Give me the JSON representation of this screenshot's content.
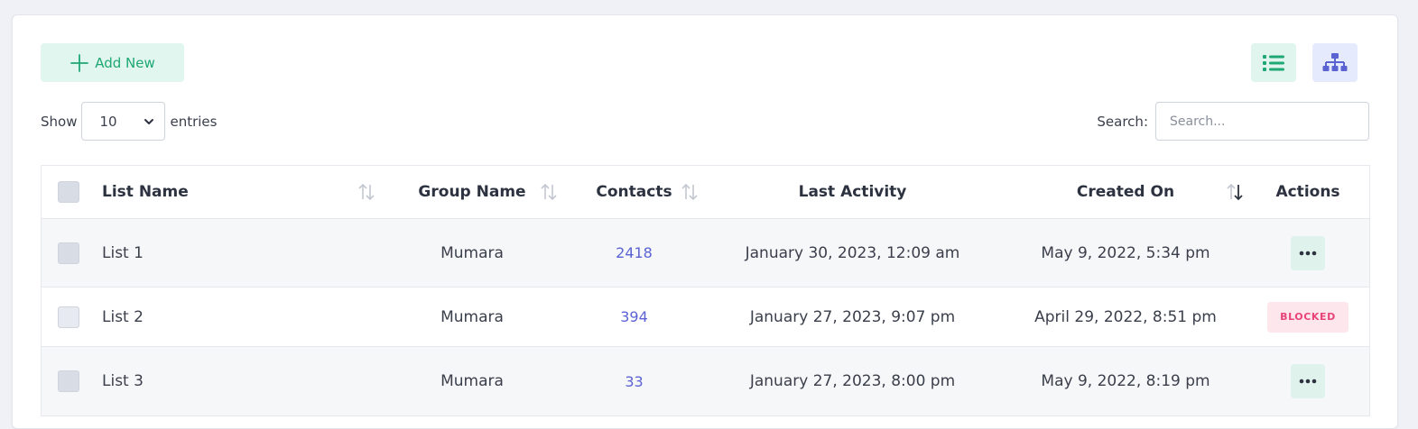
{
  "toolbar": {
    "add_new_label": "Add New",
    "show_label": "Show",
    "entries_label": "entries",
    "page_size": "10",
    "search_label": "Search:",
    "search_placeholder": "Search..."
  },
  "icons": {
    "add": "plus-icon",
    "list_view": "list-view-icon",
    "tree_view": "hierarchy-icon",
    "sort": "sort-arrows-icon",
    "more": "more-dots-icon",
    "dropdown": "chevron-down-icon"
  },
  "colors": {
    "accent_green": "#1fa774",
    "accent_blue": "#5b63d3",
    "blocked_text": "#e8437a",
    "blocked_bg": "#fde6ec"
  },
  "table": {
    "headers": {
      "list_name": "List Name",
      "group_name": "Group Name",
      "contacts": "Contacts",
      "last_activity": "Last Activity",
      "created_on": "Created On",
      "actions": "Actions"
    },
    "rows": [
      {
        "name": "List 1",
        "group": "Mumara",
        "contacts": "2418",
        "last_activity": "January 30, 2023, 12:09 am",
        "created_on": "May 9, 2022, 5:34 pm",
        "action": "more"
      },
      {
        "name": "List 2",
        "group": "Mumara",
        "contacts": "394",
        "last_activity": "January 27, 2023, 9:07 pm",
        "created_on": "April 29, 2022, 8:51 pm",
        "action": "blocked",
        "badge": "BLOCKED"
      },
      {
        "name": "List 3",
        "group": "Mumara",
        "contacts": "33",
        "last_activity": "January 27, 2023, 8:00 pm",
        "created_on": "May 9, 2022, 8:19 pm",
        "action": "more"
      }
    ]
  }
}
